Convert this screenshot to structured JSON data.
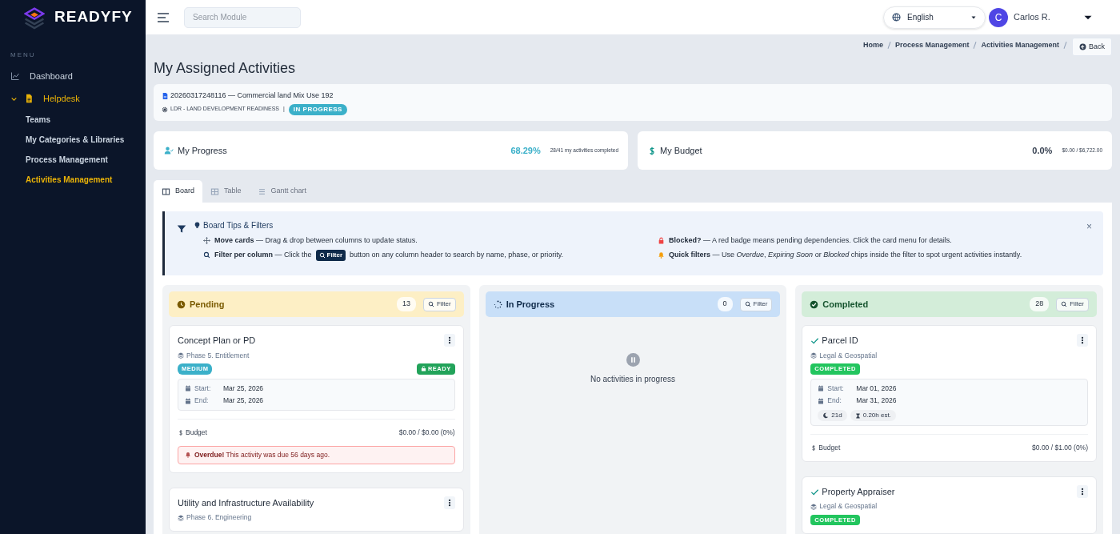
{
  "brand": {
    "name": "READYFY"
  },
  "sidebar": {
    "heading": "MENU",
    "items": [
      {
        "label": "Dashboard",
        "selected": false
      },
      {
        "label": "Helpdesk",
        "selected": true,
        "expanded": true,
        "children": [
          {
            "label": "Teams",
            "selected": false
          },
          {
            "label": "My Categories & Libraries",
            "selected": false
          },
          {
            "label": "Process Management",
            "selected": false
          },
          {
            "label": "Activities Management",
            "selected": true
          }
        ]
      }
    ]
  },
  "topbar": {
    "search": {
      "placeholder": "Search Module"
    },
    "language": "English",
    "user": {
      "initial": "C",
      "name": "Carlos R."
    }
  },
  "breadcrumb": [
    "Home",
    "Process Management",
    "Activities Management"
  ],
  "back_button": "Back",
  "page_title": "My Assigned Activities",
  "project": {
    "title": "20260317248116 — Commercial land Mix Use 192",
    "process": "LDR - LAND DEVELOPMENT READINESS",
    "separator": "|",
    "status": "IN PROGRESS"
  },
  "stats": [
    {
      "kind": "progress",
      "label": "My Progress",
      "value": "68.29%",
      "detail": "28/41 my activities completed"
    },
    {
      "kind": "budget",
      "label": "My Budget",
      "value": "0.0%",
      "detail": "$0.00 / $6,722.00"
    }
  ],
  "tabs": [
    {
      "label": "Board",
      "selected": true
    },
    {
      "label": "Table",
      "selected": false
    },
    {
      "label": "Gantt chart",
      "selected": false
    }
  ],
  "tips": {
    "title": "Board Tips & Filters",
    "close": "×",
    "items": [
      {
        "text": "**Move cards** — Drag & drop between columns to update status."
      },
      {
        "text": "**Blocked?** — A red badge means pending dependencies. Click the card menu for details."
      },
      {
        "text": "**Filter per column** — Click the",
        "chip": "Filter",
        "after": "button on any column header to search by name, phase, or priority."
      },
      {
        "text": "**Quick filters** — Use *Overdue*, *Expiring Soon* or *Blocked* chips inside the filter to spot urgent activities instantly."
      }
    ]
  },
  "columns": [
    {
      "kind": "pending",
      "title": "Pending",
      "count": "13",
      "filter": "Filter",
      "cards": [
        {
          "kind": "pending",
          "title": "Concept Plan or PD",
          "phase": "Phase 5. Entitlement",
          "priority": "MEDIUM",
          "status": "READY",
          "start_label": "Start:",
          "start": "Mar 25, 2026",
          "end_label": "End:",
          "end": "Mar 25, 2026",
          "budget_label": "Budget",
          "budget": "$0.00 / $0.00 (0%)",
          "alert": "**Overdue!** This activity was due 56 days ago."
        },
        {
          "kind": "pending",
          "title": "Utility and Infrastructure Availability",
          "phase": "Phase 6. Engineering"
        }
      ]
    },
    {
      "kind": "progress",
      "title": "In Progress",
      "count": "0",
      "filter": "Filter",
      "empty": "No activities in progress"
    },
    {
      "kind": "completed",
      "title": "Completed",
      "count": "28",
      "filter": "Filter",
      "cards": [
        {
          "kind": "completed",
          "title": "Parcel ID",
          "phase": "Legal & Geospatial",
          "status": "COMPLETED",
          "start_label": "Start:",
          "start": "Mar 01, 2026",
          "end_label": "End:",
          "end": "Mar 31, 2026",
          "duration": "21d",
          "estimate": "0.20h est.",
          "budget_label": "Budget",
          "budget": "$0.00 / $1.00 (0%)"
        },
        {
          "kind": "completed",
          "title": "Property Appraiser",
          "phase": "Legal & Geospatial",
          "status": "COMPLETED"
        }
      ]
    }
  ]
}
